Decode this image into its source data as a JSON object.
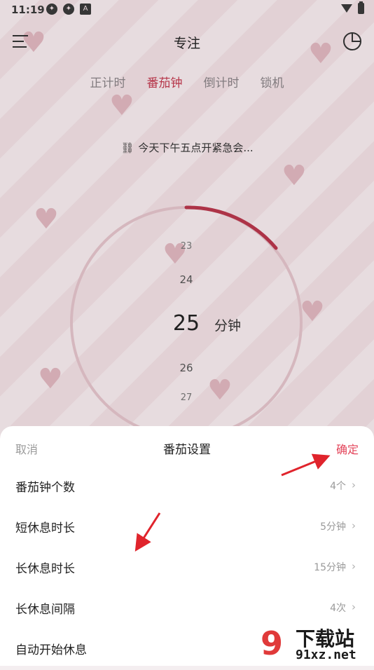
{
  "status_bar": {
    "time": "11:19"
  },
  "header": {
    "title": "专注"
  },
  "mode_tabs": [
    {
      "label": "正计时",
      "active": false
    },
    {
      "label": "番茄钟",
      "active": true
    },
    {
      "label": "倒计时",
      "active": false
    },
    {
      "label": "锁机",
      "active": false
    }
  ],
  "task": {
    "text": "今天下午五点开紧急会..."
  },
  "picker": {
    "values": [
      "23",
      "24",
      "25",
      "26",
      "27"
    ],
    "selected": "25",
    "unit": "分钟"
  },
  "sheet": {
    "cancel_label": "取消",
    "title": "番茄设置",
    "confirm_label": "确定",
    "rows": [
      {
        "label": "番茄钟个数",
        "value": "4个"
      },
      {
        "label": "短休息时长",
        "value": "5分钟"
      },
      {
        "label": "长休息时长",
        "value": "15分钟"
      },
      {
        "label": "长休息间隔",
        "value": "4次"
      },
      {
        "label": "自动开始休息",
        "value": ""
      }
    ]
  },
  "watermark": {
    "logo": "9",
    "title": "下载站",
    "url": "91xz.net"
  },
  "colors": {
    "accent": "#e3445a",
    "active_tab": "#c23a4f",
    "background": "#f1dfe3"
  }
}
